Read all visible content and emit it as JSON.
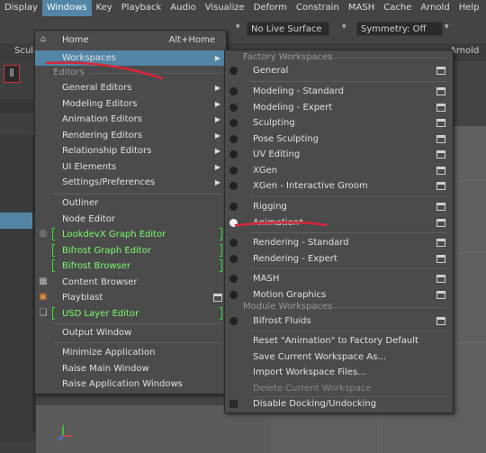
{
  "menubar": {
    "items": [
      "Display",
      "Windows",
      "Key",
      "Playback",
      "Audio",
      "Visualize",
      "Deform",
      "Constrain",
      "MASH",
      "Cache",
      "Arnold",
      "Help"
    ]
  },
  "toolbar": {
    "live_surface": "No Live Surface",
    "symmetry": "Symmetry: Off"
  },
  "shelf": {
    "left_tab": "Sculp",
    "right_tab": "Arnold"
  },
  "windows_menu": {
    "home": "Home",
    "home_shortcut": "Alt+Home",
    "workspaces": "Workspaces",
    "editors_section": "Editors",
    "submenus": [
      "General Editors",
      "Modeling Editors",
      "Animation Editors",
      "Rendering Editors",
      "Relationship Editors",
      "UI Elements",
      "Settings/Preferences"
    ],
    "outliner": "Outliner",
    "node_editor": "Node Editor",
    "lookdevx": "LookdevX Graph Editor",
    "bifrost_graph": "Bifrost Graph Editor",
    "bifrost_browser": "Bifrost Browser",
    "content_browser": "Content Browser",
    "playblast": "Playblast",
    "usd_layer": "USD Layer Editor",
    "output_window": "Output Window",
    "minimize": "Minimize Application",
    "raise_main": "Raise Main Window",
    "raise_app": "Raise Application Windows"
  },
  "workspaces_menu": {
    "factory_section": "Factory Workspaces",
    "general": "General",
    "factory_items": [
      "Modeling - Standard",
      "Modeling - Expert",
      "Sculpting",
      "Pose Sculpting",
      "UV Editing",
      "XGen",
      "XGen - Interactive Groom"
    ],
    "rigging": "Rigging",
    "animation": "Animation*",
    "rendering_items": [
      "Rendering - Standard",
      "Rendering - Expert"
    ],
    "mash": "MASH",
    "motion_graphics": "Motion Graphics",
    "module_section": "Module Workspaces",
    "bifrost_fluids": "Bifrost Fluids",
    "reset": "Reset \"Animation\" to Factory Default",
    "save": "Save Current Workspace As...",
    "import": "Import Workspace Files...",
    "delete": "Delete Current Workspace",
    "disable_docking": "Disable Docking/Undocking"
  },
  "colors": {
    "highlight": "#5285a6",
    "green_text": "#7bfc6e",
    "annotation_red": "#d6263a"
  }
}
